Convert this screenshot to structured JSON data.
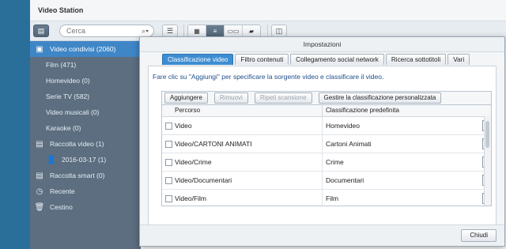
{
  "app": {
    "title": "Video Station"
  },
  "toolbar": {
    "search_placeholder": "Cerca",
    "search_icon": "search-icon",
    "view_buttons": [
      "grid-view-icon",
      "list-view-icon",
      "detail-view-icon",
      "folder-icon"
    ],
    "extra_button_icon": "subtitle-icon"
  },
  "sidebar": {
    "items": [
      {
        "label": "Video condivisi (2060)",
        "icon": "film-icon",
        "selected": true
      },
      {
        "label": "Film (471)"
      },
      {
        "label": "Homevideo (0)"
      },
      {
        "label": "Serie TV (582)"
      },
      {
        "label": "Video musicali (0)"
      },
      {
        "label": "Karaoke (0)"
      },
      {
        "label": "Raccolta video (1)",
        "icon": "collection-icon"
      },
      {
        "label": "2016-03-17 (1)",
        "icon": "person-icon"
      },
      {
        "label": "Raccolta smart (0)",
        "icon": "smart-collection-icon"
      },
      {
        "label": "Recente",
        "icon": "clock-icon"
      },
      {
        "label": "Cestino",
        "icon": "trash-icon"
      }
    ]
  },
  "dialog": {
    "title": "Impostazioni",
    "tabs": [
      "Classificazione video",
      "Filtro contenuti",
      "Collegamento social network",
      "Ricerca sottotitoli",
      "Vari"
    ],
    "hint": "Fare clic su \"Aggiungi\" per specificare la sorgente video e classificare il video.",
    "buttons": {
      "add": "Aggiungere",
      "remove": "Rimuovi",
      "rescan": "Ripeti scansione",
      "manage": "Gestire la classificazione personalizzata"
    },
    "table": {
      "headers": [
        "Percorso",
        "Classificazione predefinita"
      ],
      "rows": [
        {
          "path": "Video",
          "class": "Homevideo"
        },
        {
          "path": "Video/CARTONI ANIMATI",
          "class": "Cartoni Animati"
        },
        {
          "path": "Video/Crime",
          "class": "Crime"
        },
        {
          "path": "Video/Documentari",
          "class": "Documentari"
        },
        {
          "path": "Video/Film",
          "class": "Film"
        }
      ]
    },
    "close": "Chiudi"
  }
}
